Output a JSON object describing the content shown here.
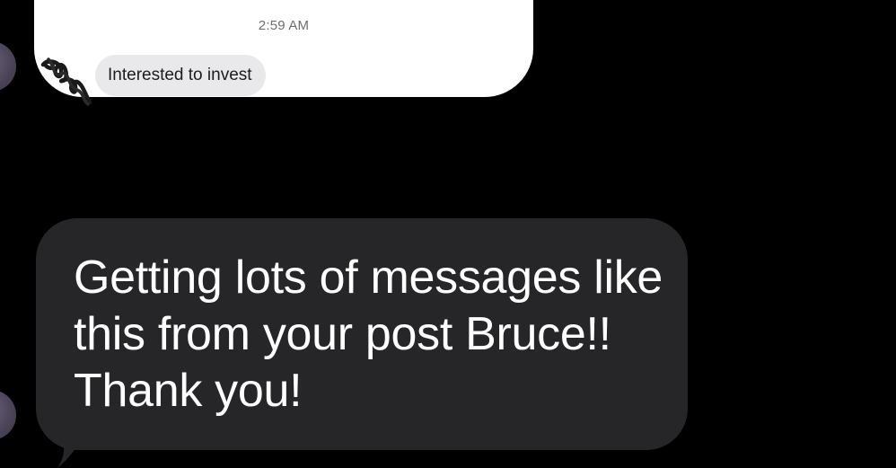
{
  "embedded_screenshot": {
    "timestamp": "2:59 AM",
    "incoming_message": "Interested to invest"
  },
  "conversation": {
    "message": "Getting lots of messages like this from your post Bruce!! Thank you!"
  },
  "colors": {
    "background": "#000000",
    "card": "#ffffff",
    "inner_bubble": "#e9e9eb",
    "message_bubble": "#262628",
    "message_text": "#ffffff",
    "timestamp_text": "#6e6e73"
  },
  "icons": {
    "redaction": "scribble-redaction",
    "avatar": "contact-avatar"
  }
}
